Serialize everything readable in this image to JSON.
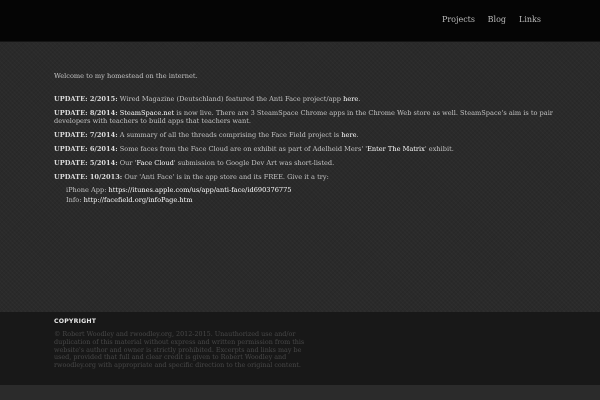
{
  "nav": {
    "projects": "Projects",
    "blog": "Blog",
    "links": "Links"
  },
  "intro": "Welcome to my homestead on the internet.",
  "updates": [
    {
      "date": "UPDATE: 2/2015:",
      "text_before": " Wired Magazine (Deutschland) featured the Anti Face project/app ",
      "link": "here",
      "text_after": "."
    },
    {
      "date": "UPDATE: 8/2014:",
      "text_before": " ",
      "link": "SteamSpace.net",
      "text_after": " is now live. There are 3 SteamSpace Chrome apps in the Chrome Web store as well. SteamSpace's aim is to pair developers with teachers to build apps that teachers want."
    },
    {
      "date": "UPDATE: 7/2014:",
      "text_before": " A summary of all the threads comprising the Face Field project is ",
      "link": "here",
      "text_after": "."
    },
    {
      "date": "UPDATE: 6/2014:",
      "text_before": " Some faces from the Face Cloud are on exhibit as part of Adelheid Mers' '",
      "link": "Enter The Matrix",
      "text_after": "' exhibit."
    },
    {
      "date": "UPDATE: 5/2014:",
      "text_before": " Our '",
      "link": "Face Cloud",
      "text_after": "' submission to Google Dev Art was short-listed."
    },
    {
      "date": "UPDATE: 10/2013:",
      "text_before": " Our 'Anti Face' is in the app store and its FREE. Give it a try:",
      "link": "",
      "text_after": ""
    }
  ],
  "app_links": {
    "iphone_label": "iPhone App: ",
    "iphone_url": "https://itunes.apple.com/us/app/anti-face/id690376775",
    "info_label": "Info: ",
    "info_url": "http://facefield.org/infoPage.htm"
  },
  "footer": {
    "title": "COPYRIGHT",
    "text": "© Robert Woodley and rwoodley.org, 2012-2015. Unauthorized use and/or duplication of this material without express and written permission from this website's author and owner is strictly prohibited. Excerpts and links may be used, provided that full and clear credit is given to Robert Woodley and rwoodley.org with appropriate and specific direction to the original content."
  }
}
